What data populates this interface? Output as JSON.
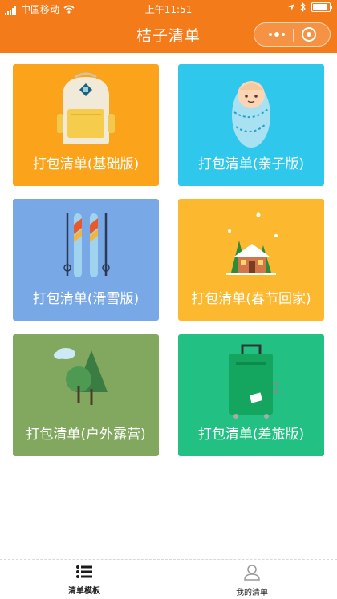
{
  "status_bar": {
    "carrier": "中国移动",
    "time": "上午11:51",
    "battery_pct": 90
  },
  "header": {
    "title": "桔子清单"
  },
  "cards": [
    {
      "label": "打包清单(基础版)",
      "color": "#fba41b",
      "icon": "backpack-icon"
    },
    {
      "label": "打包清单(亲子版)",
      "color": "#2fc8ec",
      "icon": "baby-icon"
    },
    {
      "label": "打包清单(滑雪版)",
      "color": "#78a8e6",
      "icon": "ski-icon"
    },
    {
      "label": "打包清单(春节回家)",
      "color": "#fcb82e",
      "icon": "house-icon"
    },
    {
      "label": "打包清单(户外露营)",
      "color": "#82a85f",
      "icon": "trees-icon"
    },
    {
      "label": "打包清单(差旅版)",
      "color": "#22c083",
      "icon": "suitcase-icon"
    }
  ],
  "tabbar": {
    "tabs": [
      {
        "label": "清单模板",
        "icon": "list-icon",
        "active": true
      },
      {
        "label": "我的清单",
        "icon": "person-icon",
        "active": false
      }
    ]
  },
  "colors": {
    "header_bg": "#f47b1a"
  }
}
